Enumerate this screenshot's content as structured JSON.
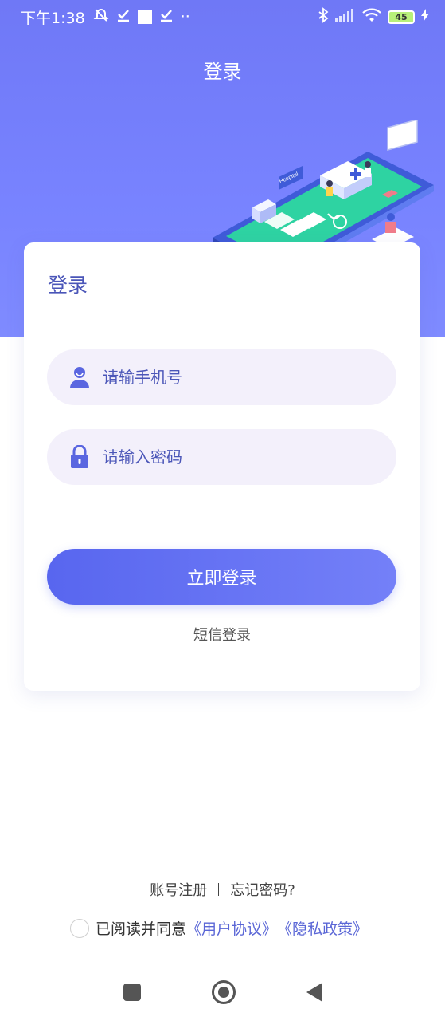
{
  "status_bar": {
    "time": "下午1:38",
    "icons": [
      "muted-alarm-icon",
      "check-icon",
      "square-icon",
      "check-icon",
      "more-dots-icon"
    ],
    "dots": "··",
    "right_icons": [
      "bluetooth-icon",
      "signal-icon",
      "wifi-icon",
      "battery-icon",
      "charging-icon"
    ],
    "battery_level": "45"
  },
  "header": {
    "title": "登录"
  },
  "card": {
    "title": "登录",
    "phone_placeholder": "请输手机号",
    "password_placeholder": "请输入密码",
    "login_button": "立即登录",
    "sms_login": "短信登录"
  },
  "illustration": {
    "sign_text": "Hospital"
  },
  "footer": {
    "register": "账号注册",
    "forgot": "忘记密码?",
    "agree_text": "已阅读并同意",
    "user_agreement": "《用户协议》",
    "privacy_policy": "《隐私政策》"
  },
  "nav_bar": {
    "icons": [
      "recent-apps-icon",
      "home-icon",
      "back-icon"
    ]
  },
  "colors": {
    "hero": "#7681fb",
    "accent": "#5866ef",
    "field_bg": "#f3f0fb",
    "link": "#5a66d6"
  }
}
